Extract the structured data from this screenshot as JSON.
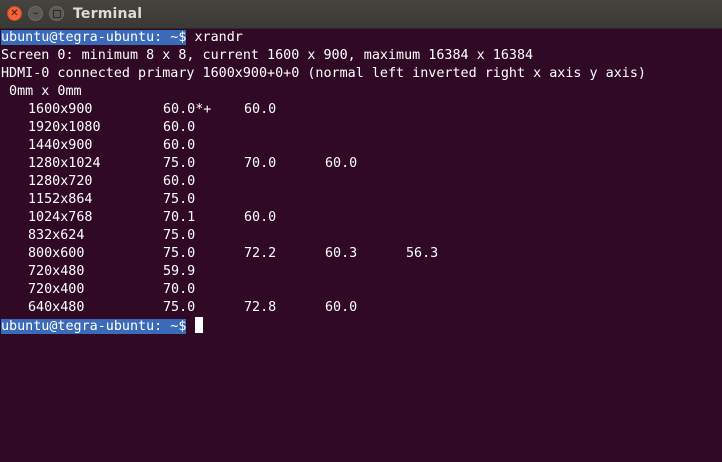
{
  "window": {
    "title": "Terminal",
    "close_glyph": "✕",
    "minimize_glyph": "–"
  },
  "terminal": {
    "prompt": "ubuntu@tegra-ubuntu: ~$",
    "command": " xrandr",
    "screen_line": "Screen 0: minimum 8 x 8, current 1600 x 900, maximum 16384 x 16384",
    "output_line": "HDMI-0 connected primary 1600x900+0+0 (normal left inverted right x axis y axis)",
    "size_line": " 0mm x 0mm",
    "modes": [
      {
        "res": "1600x900",
        "rates": [
          "60.0*+",
          "60.0"
        ]
      },
      {
        "res": "1920x1080",
        "rates": [
          "60.0"
        ]
      },
      {
        "res": "1440x900",
        "rates": [
          "60.0"
        ]
      },
      {
        "res": "1280x1024",
        "rates": [
          "75.0",
          "70.0",
          "60.0"
        ]
      },
      {
        "res": "1280x720",
        "rates": [
          "60.0"
        ]
      },
      {
        "res": "1152x864",
        "rates": [
          "75.0"
        ]
      },
      {
        "res": "1024x768",
        "rates": [
          "70.1",
          "60.0"
        ]
      },
      {
        "res": "832x624",
        "rates": [
          "75.0"
        ]
      },
      {
        "res": "800x600",
        "rates": [
          "75.0",
          "72.2",
          "60.3",
          "56.3"
        ]
      },
      {
        "res": "720x480",
        "rates": [
          "59.9"
        ]
      },
      {
        "res": "720x400",
        "rates": [
          "70.0"
        ]
      },
      {
        "res": "640x480",
        "rates": [
          "75.0",
          "72.8",
          "60.0"
        ]
      }
    ]
  }
}
